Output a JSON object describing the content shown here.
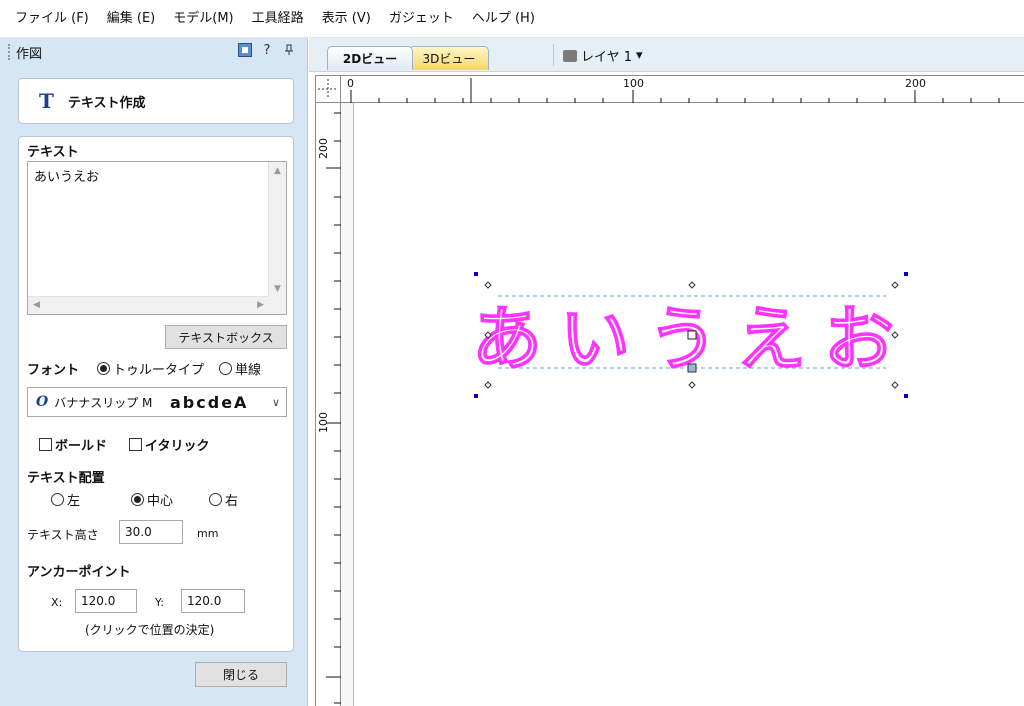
{
  "menu": [
    "ファイル (F)",
    "編集 (E)",
    "モデル(M)",
    "工具経路",
    "表示 (V)",
    "ガジェット",
    "ヘルプ (H)"
  ],
  "panel": {
    "title": "作図",
    "header_icons": [
      "dock-icon",
      "help-icon",
      "pin-icon"
    ],
    "help_glyph": "?",
    "tool_title": "テキスト作成",
    "tool_icon_glyph": "T"
  },
  "form": {
    "text_label": "テキスト",
    "text_value": "あいうえお",
    "textbox_button": "テキストボックス",
    "font_label": "フォント",
    "font_type_truetype": "トゥルータイプ",
    "font_type_single": "単線",
    "font_type_selected": "truetype",
    "font_name": "バナナスリップ M",
    "font_sample": "abcdeA",
    "font_icon_glyph": "O",
    "bold_label": "ボールド",
    "italic_label": "イタリック",
    "bold_checked": false,
    "italic_checked": false,
    "align_label": "テキスト配置",
    "align_left": "左",
    "align_center": "中心",
    "align_right": "右",
    "align_selected": "center",
    "height_label": "テキスト高さ",
    "height_value": "30.0",
    "height_unit": "mm",
    "anchor_label": "アンカーポイント",
    "x_label": "X:",
    "x_value": "120.0",
    "y_label": "Y:",
    "y_value": "120.0",
    "anchor_hint": "(クリックで位置の決定)",
    "close_button": "閉じる"
  },
  "view": {
    "tab_2d": "2Dビュー",
    "tab_3d": "3Dビュー",
    "active_tab": "2Dビュー",
    "layer_label": "レイヤ 1",
    "layer_arrow": "▾",
    "ruler_h_labels": [
      "0",
      "100",
      "200"
    ],
    "ruler_v_labels": [
      "200",
      "100"
    ],
    "canvas_text": "あいうえお",
    "text_color": "#ff33ff",
    "guide_color": "#6aa0d8",
    "handle_color": "#0000cc"
  },
  "colors": {
    "panel_bg": "#d6e6f4",
    "tab_2d_bg": "#ffffff",
    "tab_3d_bg": "#f5d66b",
    "accent": "#1d3d8f"
  }
}
